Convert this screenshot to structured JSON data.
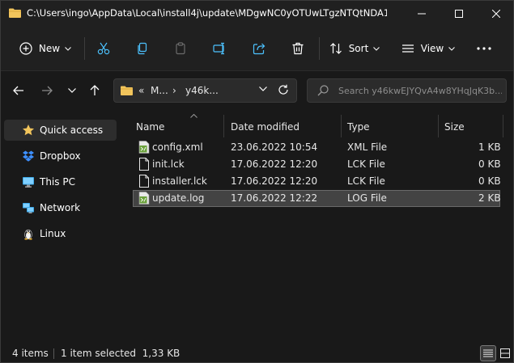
{
  "window": {
    "title": "C:\\Users\\ingo\\AppData\\Local\\install4j\\update\\MDgwNC0yOTUwLTgzNTQtNDA1MA..."
  },
  "toolbar": {
    "new_label": "New",
    "sort_label": "Sort",
    "view_label": "View"
  },
  "address": {
    "overflow": "«",
    "part1": "M...",
    "separator": "›",
    "part2": "y46k..."
  },
  "search": {
    "placeholder": "Search y46kwEJYQvA4w8YHqJqK3b..."
  },
  "sidebar": {
    "items": [
      {
        "label": "Quick access",
        "icon": "star-icon"
      },
      {
        "label": "Dropbox",
        "icon": "dropbox-icon"
      },
      {
        "label": "This PC",
        "icon": "monitor-icon"
      },
      {
        "label": "Network",
        "icon": "network-icon"
      },
      {
        "label": "Linux",
        "icon": "penguin-icon"
      }
    ]
  },
  "columns": {
    "name": "Name",
    "date": "Date modified",
    "type": "Type",
    "size": "Size"
  },
  "files": [
    {
      "name": "config.xml",
      "date": "23.06.2022 10:54",
      "type": "XML File",
      "size": "1 KB"
    },
    {
      "name": "init.lck",
      "date": "17.06.2022 12:20",
      "type": "LCK File",
      "size": "0 KB"
    },
    {
      "name": "installer.lck",
      "date": "17.06.2022 12:20",
      "type": "LCK File",
      "size": "0 KB"
    },
    {
      "name": "update.log",
      "date": "17.06.2022 12:22",
      "type": "LOG File",
      "size": "2 KB"
    }
  ],
  "status": {
    "count": "4 items",
    "selection": "1 item selected  1,33 KB"
  },
  "colors": {
    "folder": "#f2c55c",
    "accent": "#4cc2ff",
    "background": "#191919"
  }
}
